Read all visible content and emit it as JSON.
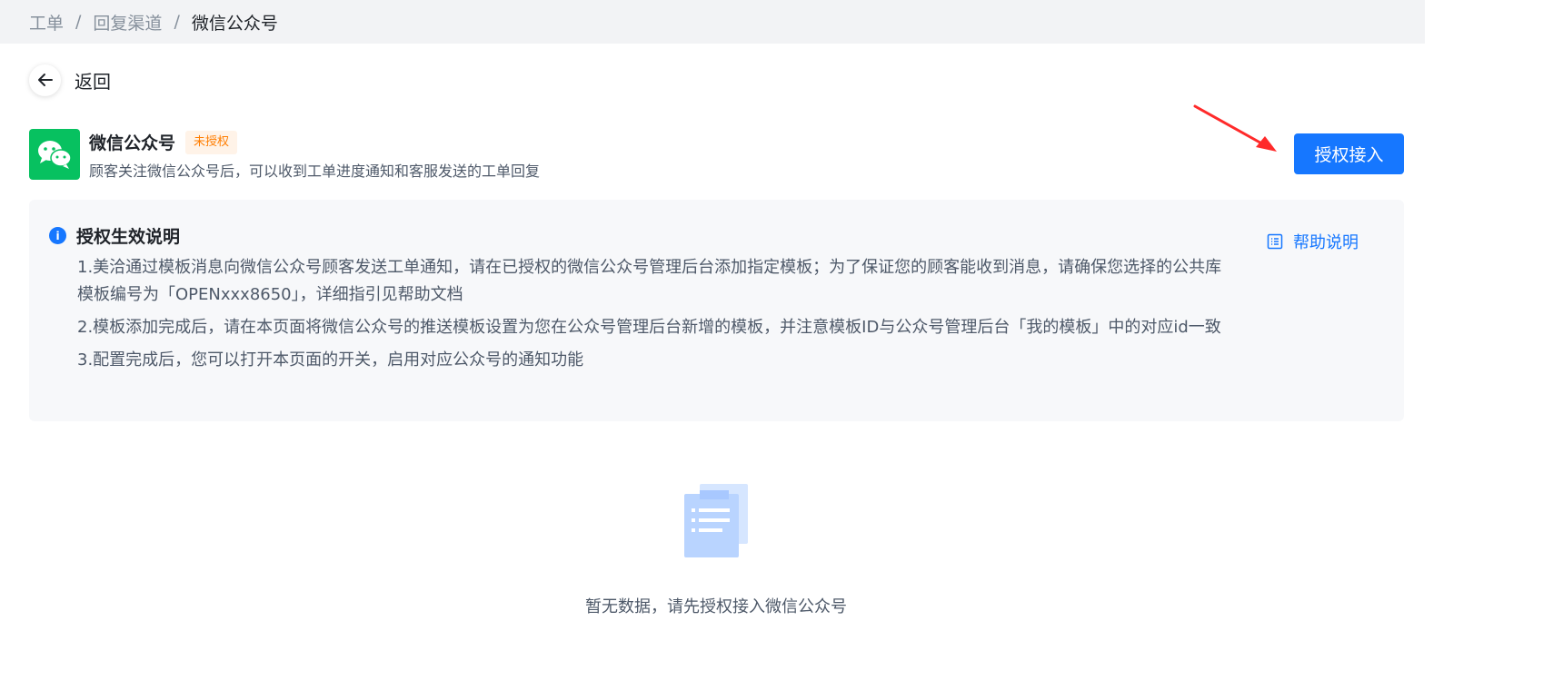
{
  "breadcrumb": {
    "items": [
      "工单",
      "回复渠道"
    ],
    "separator": "/",
    "current": "微信公众号"
  },
  "back": {
    "label": "返回"
  },
  "channel": {
    "title": "微信公众号",
    "status": "未授权",
    "description": "顾客关注微信公众号后，可以收到工单进度通知和客服发送的工单回复",
    "logo_color": "#07c160"
  },
  "auth_button": {
    "label": "授权接入",
    "color": "#1677ff"
  },
  "info": {
    "title": "授权生效说明",
    "help_link": "帮助说明",
    "items": [
      "1.美洽通过模板消息向微信公众号顾客发送工单通知，请在已授权的微信公众号管理后台添加指定模板；为了保证您的顾客能收到消息，请确保您选择的公共库模板编号为「OPENxxx8650」，详细指引见帮助文档",
      "2.模板添加完成后，请在本页面将微信公众号的推送模板设置为您在公众号管理后台新增的模板，并注意模板ID与公众号管理后台「我的模板」中的对应id一致",
      "3.配置完成后，您可以打开本页面的开关，启用对应公众号的通知功能"
    ]
  },
  "empty": {
    "text": "暂无数据，请先授权接入微信公众号"
  },
  "colors": {
    "accent": "#1677ff",
    "warning": "#ff7d00",
    "annotation_arrow": "#ff2a2a"
  },
  "icons": [
    "back-arrow-icon",
    "wechat-icon",
    "info-icon",
    "list-icon",
    "empty-document-icon"
  ]
}
